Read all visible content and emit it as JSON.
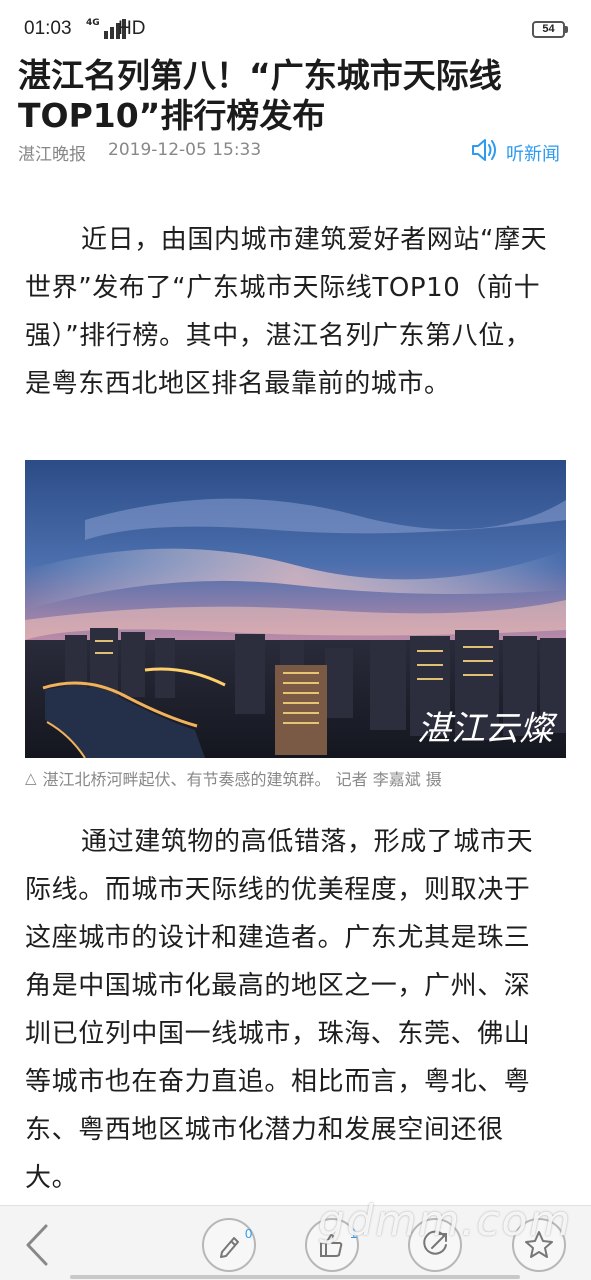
{
  "status_bar": {
    "time": "01:03",
    "network": "4G",
    "hd": "HD",
    "battery": "54"
  },
  "article": {
    "title": "湛江名列第八！“广东城市天际线TOP10”排行榜发布",
    "source": "湛江晚报",
    "datetime": "2019-12-05 15:33",
    "listen_label": "听新闻",
    "paragraph1": "近日，由国内城市建筑爱好者网站“摩天世界”发布了“广东城市天际线TOP10（前十强）”排行榜。其中，湛江名列广东第八位，是粤东西北地区排名最靠前的城市。",
    "photo_signature": "湛江云燦",
    "caption_icon": "triangle-icon",
    "caption": "湛江北桥河畔起伏、有节奏感的建筑群。 记者 李嘉斌 摄",
    "paragraph2": "通过建筑物的高低错落，形成了城市天际线。而城市天际线的优美程度，则取决于这座城市的设计和建造者。广东尤其是珠三角是中国城市化最高的地区之一，广州、深圳已位列中国一线城市，珠海、东莞、佛山等城市也在奋力直追。相比而言，粤北、粤东、粤西地区城市化潜力和发展空间还很大。"
  },
  "toolbar": {
    "comment_count": "0",
    "like_count": "1",
    "watermark": "gdmm.com"
  },
  "colors": {
    "accent": "#2d9af0",
    "meta_text": "#888888",
    "title_text": "#1b1b1b"
  },
  "icons": [
    "back-icon",
    "pen-icon",
    "thumbs-up-icon",
    "share-icon",
    "star-icon",
    "speaker-icon"
  ]
}
